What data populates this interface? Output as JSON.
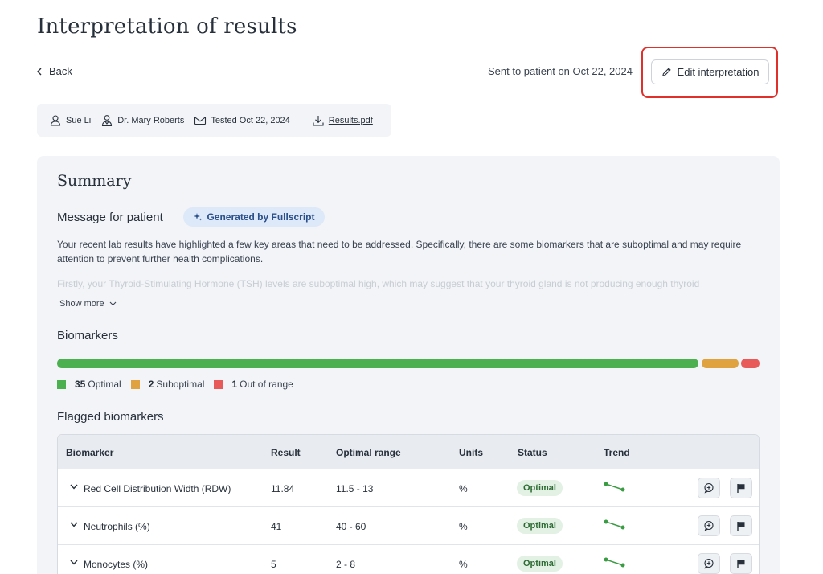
{
  "page": {
    "title": "Interpretation of results",
    "back_label": "Back",
    "sent_text": "Sent to patient on Oct 22, 2024",
    "edit_button_label": "Edit interpretation"
  },
  "meta": {
    "patient": "Sue Li",
    "doctor": "Dr. Mary Roberts",
    "tested": "Tested Oct 22, 2024",
    "file": "Results.pdf"
  },
  "summary": {
    "title": "Summary",
    "message_title": "Message for patient",
    "generated_badge": "Generated by Fullscript",
    "message_text": "Your recent lab results have highlighted a few key areas that need to be addressed. Specifically, there are some biomarkers that are suboptimal and may require attention to prevent further health complications.",
    "message_fade": "Firstly, your Thyroid-Stimulating Hormone (TSH) levels are suboptimal high, which may suggest that your thyroid gland is not producing enough thyroid",
    "show_more": "Show more"
  },
  "biomarkers": {
    "title": "Biomarkers",
    "optimal_count": "35",
    "optimal_label": "Optimal",
    "suboptimal_count": "2",
    "suboptimal_label": "Suboptimal",
    "out_count": "1",
    "out_label": "Out of range",
    "colors": {
      "optimal": "#4caf50",
      "suboptimal": "#e0a23e",
      "out_of_range": "#e85a5a"
    }
  },
  "flagged": {
    "title": "Flagged biomarkers",
    "headers": [
      "Biomarker",
      "Result",
      "Optimal range",
      "Units",
      "Status",
      "Trend"
    ],
    "rows": [
      {
        "name": "Red Cell Distribution Width (RDW)",
        "result": "11.84",
        "range": "11.5 - 13",
        "units": "%",
        "status": "Optimal"
      },
      {
        "name": "Neutrophils (%)",
        "result": "41",
        "range": "40 - 60",
        "units": "%",
        "status": "Optimal"
      },
      {
        "name": "Monocytes (%)",
        "result": "5",
        "range": "2 - 8",
        "units": "%",
        "status": "Optimal"
      }
    ]
  }
}
